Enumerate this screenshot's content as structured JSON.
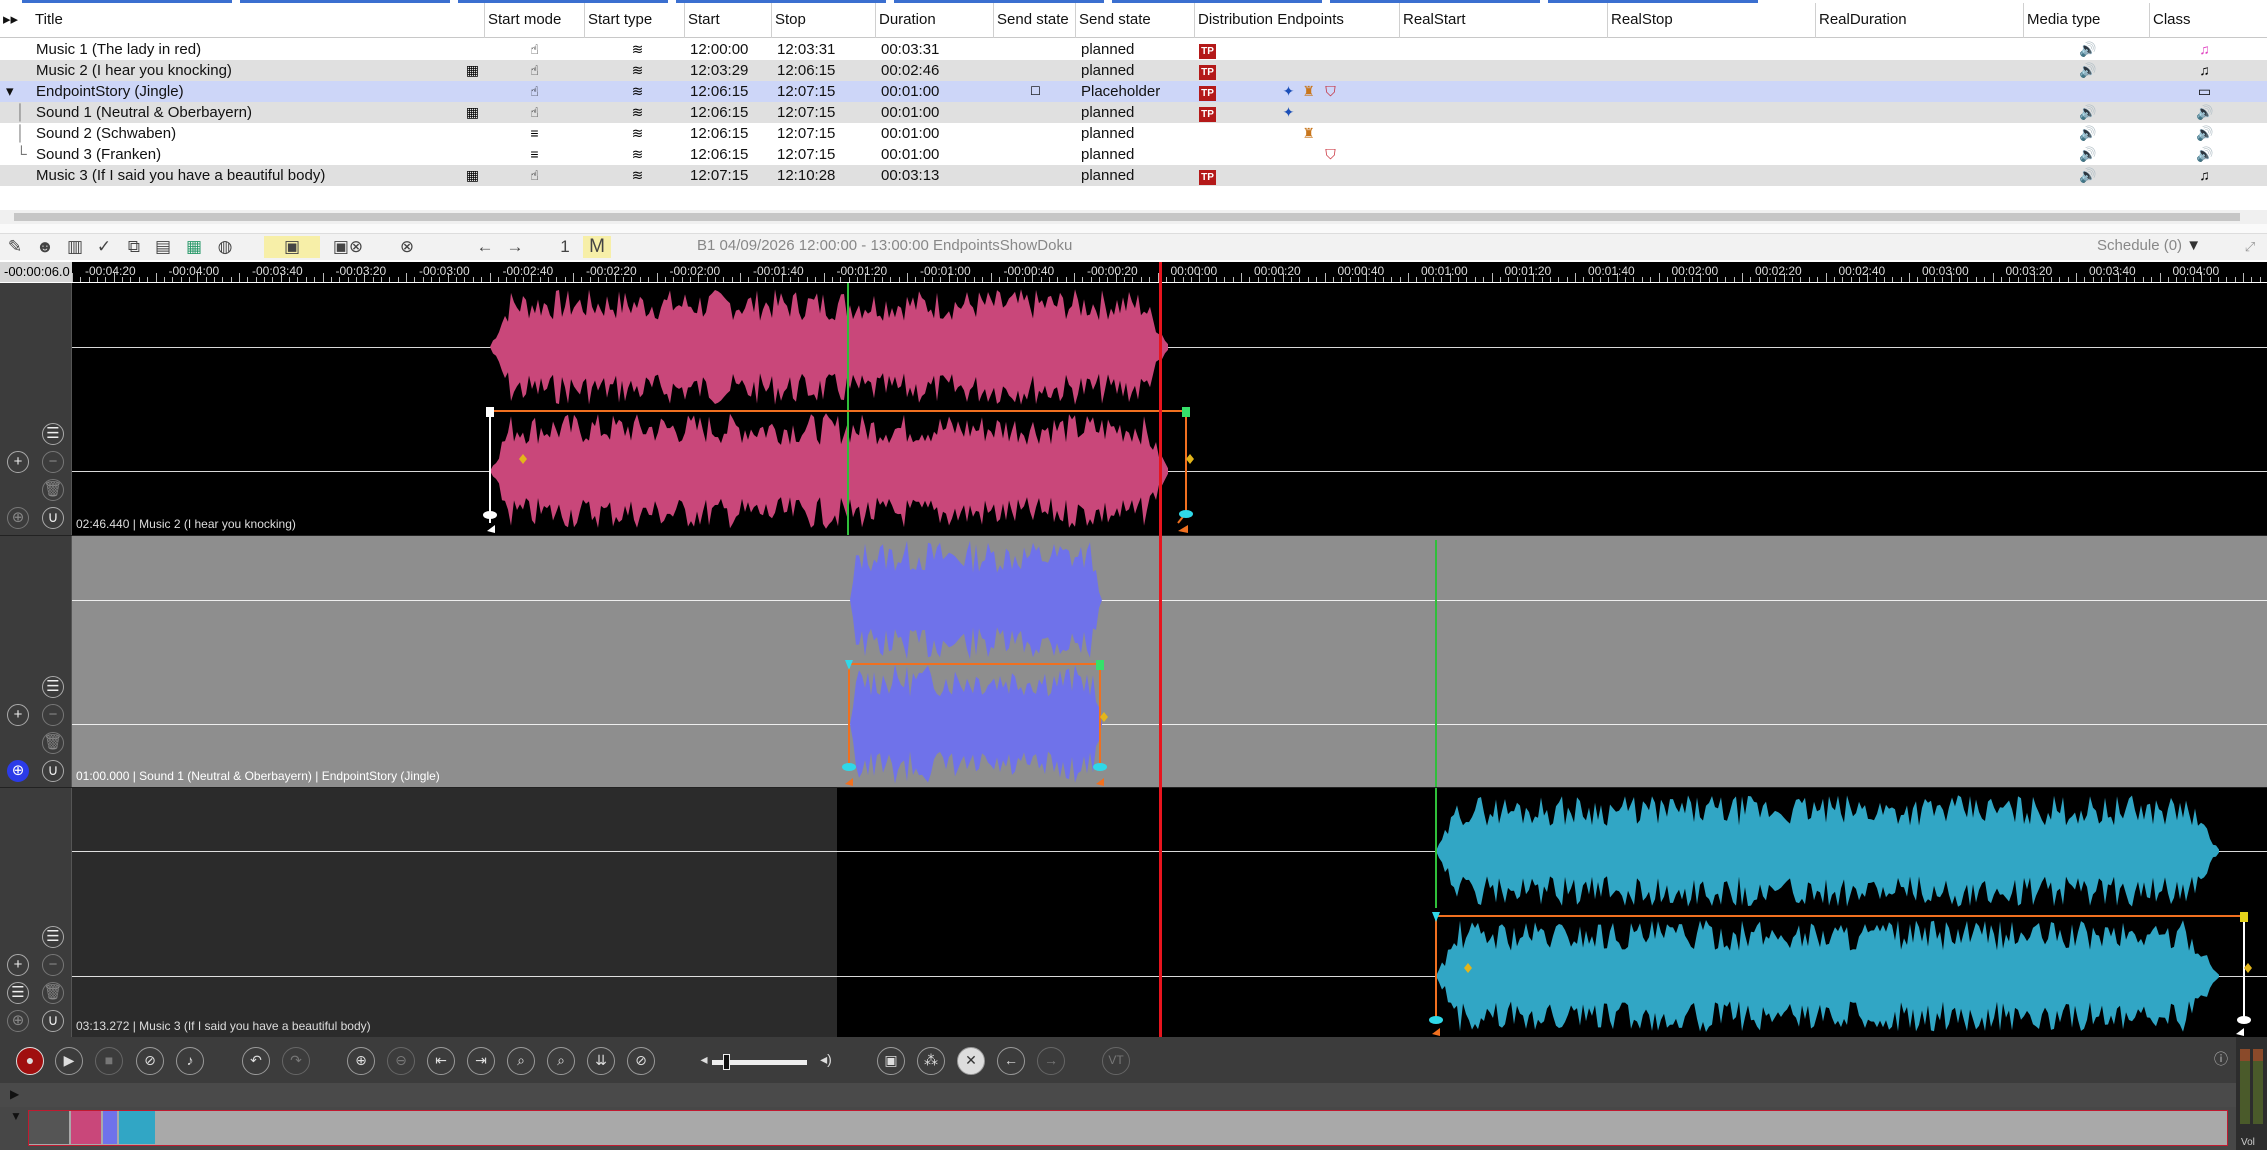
{
  "columns": [
    "Title",
    "Start mode",
    "Start type",
    "Start",
    "Stop",
    "Duration",
    "Send state",
    "Send state",
    "Distribution Endpoints",
    "RealStart",
    "RealStop",
    "RealDuration",
    "Media type",
    "Class"
  ],
  "rows": [
    {
      "title": "Music 1 (The lady in red)",
      "start": "12:00:00",
      "stop": "12:03:31",
      "duration": "00:03:31",
      "send_state": "planned",
      "tp": "TP",
      "class_color": "#e040c0"
    },
    {
      "title": "Music 2 (I hear you knocking)",
      "start": "12:03:29",
      "stop": "12:06:15",
      "duration": "00:02:46",
      "send_state": "planned",
      "tp": "TP",
      "class_color": "#222222"
    },
    {
      "title": "EndpointStory (Jingle)",
      "start": "12:06:15",
      "stop": "12:07:15",
      "duration": "00:01:00",
      "send_state": "Placeholder",
      "tp": "TP",
      "class_color": "#222222"
    },
    {
      "title": "Sound 1 (Neutral & Oberbayern)",
      "start": "12:06:15",
      "stop": "12:07:15",
      "duration": "00:01:00",
      "send_state": "planned",
      "tp": "TP",
      "class_color": "#222222"
    },
    {
      "title": "Sound 2 (Schwaben)",
      "start": "12:06:15",
      "stop": "12:07:15",
      "duration": "00:01:00",
      "send_state": "planned",
      "tp": "",
      "class_color": "#9aa020"
    },
    {
      "title": "Sound 3 (Franken)",
      "start": "12:06:15",
      "stop": "12:07:15",
      "duration": "00:01:00",
      "send_state": "planned",
      "tp": "",
      "class_color": "#9aa020"
    },
    {
      "title": "Music 3 (If I said you have a beautiful body)",
      "start": "12:07:15",
      "stop": "12:10:28",
      "duration": "00:03:13",
      "send_state": "planned",
      "tp": "TP",
      "class_color": "#222222"
    }
  ],
  "toolbar": {
    "page": "1",
    "mode": "M",
    "schedule_title": "B1 04/09/2026 12:00:00 - 13:00:00 EndpointsShowDoku",
    "schedule_select": "Schedule (0)"
  },
  "ruler": {
    "position": "-00:00:06.0",
    "ticks": [
      "-00:04:20",
      "-00:04:00",
      "-00:03:40",
      "-00:03:20",
      "-00:03:00",
      "-00:02:40",
      "-00:02:20",
      "-00:02:00",
      "-00:01:40",
      "-00:01:20",
      "-00:01:00",
      "-00:00:40",
      "-00:00:20",
      "00:00:00",
      "00:00:20",
      "00:00:40",
      "00:01:00",
      "00:01:20",
      "00:01:40",
      "00:02:00",
      "00:02:20",
      "00:02:40",
      "00:03:00",
      "00:03:20",
      "00:03:40",
      "00:04:00"
    ]
  },
  "lanes": [
    {
      "label": "02:46.440 | Music 2 (I hear you knocking)",
      "wave_color": "#c9477a"
    },
    {
      "label": "01:00.000 | Sound 1 (Neutral & Oberbayern) | EndpointStory (Jingle)",
      "wave_color": "#6f72ea"
    },
    {
      "label": "03:13.272 | Music 3 (If I said you have a beautiful body)",
      "wave_color": "#31a6c5"
    }
  ],
  "transport": {
    "vt_label": "VT",
    "volume": 0.12
  },
  "vu_label": "Vol",
  "colors": {
    "playhead": "#e8141e",
    "accent": "#3b6fd0",
    "tp_badge": "#b41919",
    "selected_row": "#cdd6f8"
  }
}
